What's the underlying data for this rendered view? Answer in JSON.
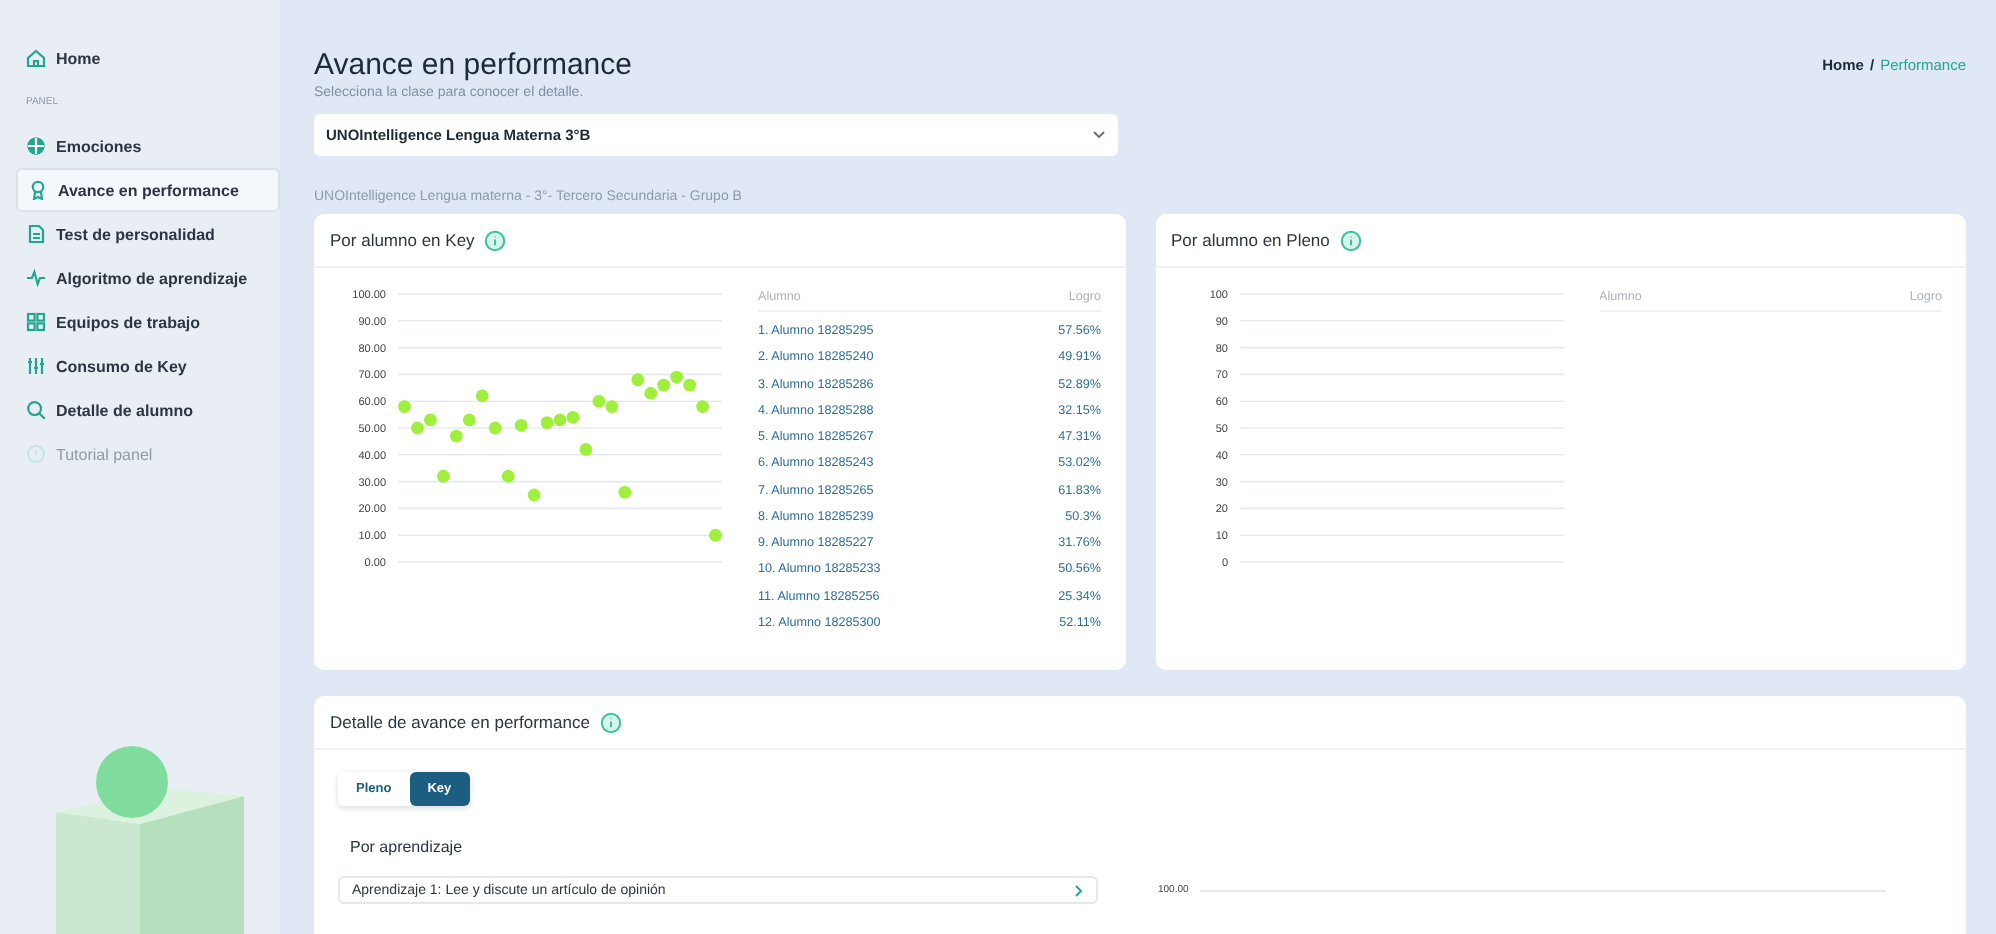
{
  "sidebar": {
    "items": [
      {
        "kind": "link",
        "label": "Home",
        "selected": false,
        "disabled": false
      },
      {
        "kind": "heading",
        "label": "PANEL"
      },
      {
        "kind": "link",
        "label": "Emociones",
        "selected": false,
        "disabled": false
      },
      {
        "kind": "link",
        "label": "Avance en performance",
        "selected": true,
        "disabled": false
      },
      {
        "kind": "link",
        "label": "Test de personalidad",
        "selected": false,
        "disabled": false
      },
      {
        "kind": "link",
        "label": "Algoritmo de aprendizaje",
        "selected": false,
        "disabled": false
      },
      {
        "kind": "link",
        "label": "Equipos de trabajo",
        "selected": false,
        "disabled": false
      },
      {
        "kind": "link",
        "label": "Consumo de Key",
        "selected": false,
        "disabled": false
      },
      {
        "kind": "link",
        "label": "Detalle de alumno",
        "selected": false,
        "disabled": false
      },
      {
        "kind": "link",
        "label": "Tutorial panel",
        "selected": false,
        "disabled": true
      }
    ]
  },
  "header": {
    "title": "Avance en performance",
    "subtitle": "Selecciona la clase para conocer el detalle.",
    "breadcrumb": [
      {
        "label": "Home",
        "selected": false
      },
      {
        "label": "Performance",
        "selected": true
      }
    ],
    "separator": "/"
  },
  "class_select": {
    "value": "UNOIntelligence Lengua Materna 3°B"
  },
  "class_caption": "UNOIntelligence Lengua materna - 3°- Tercero Secundaria - Grupo B",
  "cards": [
    {
      "title": "Por alumno en Key",
      "columns": [
        "Alumno",
        "Logro"
      ],
      "rows": [
        [
          "1. Alumno 18285295",
          "57.56%"
        ],
        [
          "2. Alumno 18285240",
          "49.91%"
        ],
        [
          "3. Alumno 18285286",
          "52.89%"
        ],
        [
          "4. Alumno 18285288",
          "32.15%"
        ],
        [
          "5. Alumno 18285267",
          "47.31%"
        ],
        [
          "6. Alumno 18285243",
          "53.02%"
        ],
        [
          "7. Alumno 18285265",
          "61.83%"
        ],
        [
          "8. Alumno 18285239",
          "50.3%"
        ],
        [
          "9. Alumno 18285227",
          "31.76%"
        ],
        [
          "10. Alumno 18285233",
          "50.56%"
        ],
        [
          "11. Alumno 18285256",
          "25.34%"
        ],
        [
          "12. Alumno 18285300",
          "52.11%"
        ]
      ],
      "chart_data": {
        "type": "scatter",
        "grid": true,
        "series": [
          {
            "color": "#9ef03c",
            "values": [
              58,
              50,
              53,
              32,
              47,
              53,
              62,
              50,
              32,
              51,
              25,
              52,
              53,
              54,
              42,
              60,
              58,
              26,
              68,
              63,
              66,
              69,
              66,
              58,
              10
            ]
          }
        ],
        "ylim": [
          0,
          100
        ],
        "yticks": [
          {
            "value": 0,
            "label": "0.00"
          },
          {
            "value": 10,
            "label": "10.00"
          },
          {
            "value": 20,
            "label": "20.00"
          },
          {
            "value": 30,
            "label": "30.00"
          },
          {
            "value": 40,
            "label": "40.00"
          },
          {
            "value": 50,
            "label": "50.00"
          },
          {
            "value": 60,
            "label": "60.00"
          },
          {
            "value": 70,
            "label": "70.00"
          },
          {
            "value": 80,
            "label": "80.00"
          },
          {
            "value": 90,
            "label": "90.00"
          },
          {
            "value": 100,
            "label": "100.00"
          }
        ]
      }
    },
    {
      "title": "Por alumno en Pleno",
      "columns": [
        "Alumno",
        "Logro"
      ],
      "axis_labels": [
        "100",
        "90",
        "80",
        "70",
        "60",
        "50",
        "40",
        "30",
        "20",
        "10",
        "0"
      ]
    }
  ],
  "detail": {
    "title": "Detalle de avance en performance",
    "tabs": [
      {
        "label": "Pleno",
        "selected": false
      },
      {
        "label": "Key",
        "selected": true
      }
    ],
    "section": "Por aprendizaje",
    "rows": [
      {
        "label": "Aprendizaje 1: Lee y discute un artículo de opinión"
      }
    ],
    "chart_tick": "100.00"
  }
}
